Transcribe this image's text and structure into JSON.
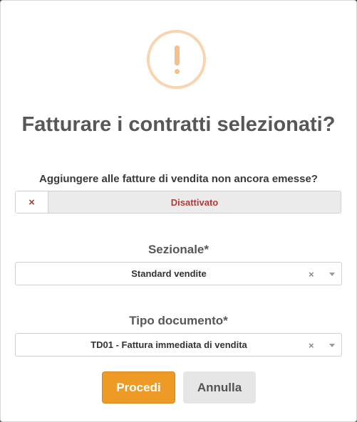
{
  "dialog": {
    "title": "Fatturare i contratti selezionati?",
    "icon": "warning-exclamation-icon",
    "accent_color": "#f5c08f"
  },
  "append_option": {
    "question": "Aggiungere alle fatture di vendita non ancora emesse?",
    "toggle_symbol": "×",
    "state_label": "Disattivato",
    "state_color": "#b33a3a"
  },
  "fields": {
    "sezionale": {
      "label": "Sezionale*",
      "value": "Standard vendite",
      "clear_symbol": "×"
    },
    "tipo_documento": {
      "label": "Tipo documento*",
      "value": "TD01 - Fattura immediata di vendita",
      "clear_symbol": "×"
    }
  },
  "buttons": {
    "confirm_label": "Procedi",
    "confirm_color": "#ee9a26",
    "cancel_label": "Annulla"
  }
}
